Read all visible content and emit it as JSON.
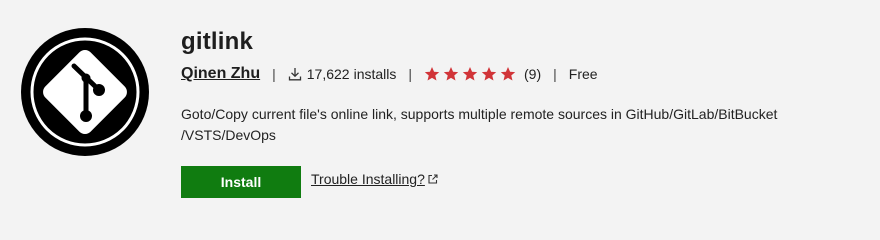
{
  "extension": {
    "name": "gitlink",
    "publisher": "Qinen Zhu",
    "installs_count": "17,622",
    "installs_label": "installs",
    "rating": 5,
    "rating_max": 5,
    "rating_count": "(9)",
    "price": "Free",
    "separator": "|",
    "description": "Goto/Copy current file's online link, supports multiple remote sources in GitHub/GitLab/BitBucket /VSTS/DevOps"
  },
  "actions": {
    "install_label": "Install",
    "trouble_label": "Trouble Installing?"
  },
  "icons": {
    "logo": "git-logo-icon",
    "download": "download-icon",
    "star": "star-icon",
    "external": "external-link-icon"
  },
  "colors": {
    "install_button": "#107c10",
    "star": "#d13438",
    "logo_bg": "#000000",
    "background": "#f3f3f3"
  }
}
